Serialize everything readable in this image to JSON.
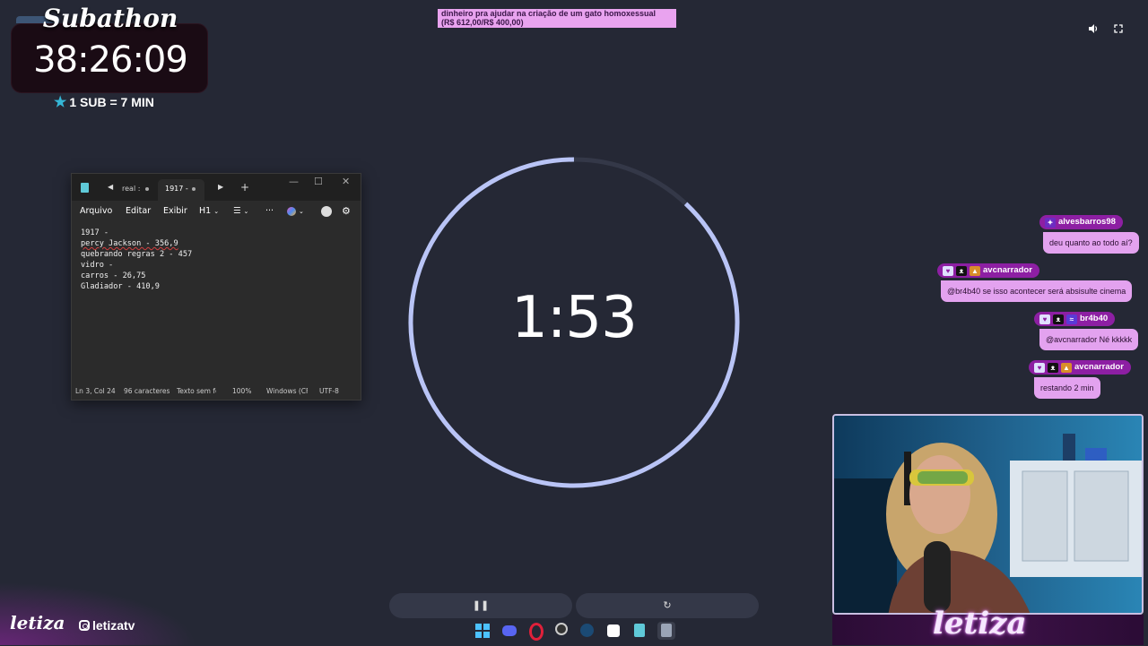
{
  "subathon": {
    "title": "Subathon",
    "time": "38:26:09",
    "rate": "1 SUB = 7 MIN"
  },
  "goal": {
    "line1": "dinheiro pra ajudar na criação de um gato homoxessual",
    "line2": "(R$ 612,00/R$ 400,00)",
    "progress": 1.0
  },
  "notepad": {
    "tabs": [
      "real :",
      "1917 -"
    ],
    "add_tab": "+",
    "menu": [
      "Arquivo",
      "Editar",
      "Exibir",
      "H1"
    ],
    "lines": [
      "1917 -",
      "percy Jackson - 356,9",
      "quebrando regras 2 - 457",
      "vidro -",
      "carros - 26,75",
      "Gladiador - 410,9"
    ],
    "status": {
      "position": "Ln 3, Col 24",
      "chars": "96 caracteres",
      "format": "Texto sem fo",
      "zoom": "100%",
      "eol": "Windows (CF",
      "encoding": "UTF-8"
    }
  },
  "timer": {
    "display": "1:53",
    "remaining_fraction": 0.88
  },
  "chat": [
    {
      "user": "alvesbarros98",
      "message": "deu quanto ao todo aí?"
    },
    {
      "user": "avcnarrador",
      "message": "@br4b40 se isso acontecer será absisulte cinema"
    },
    {
      "user": "br4b40",
      "message": "@avcnarrador Né kkkkk"
    },
    {
      "user": "avcnarrador",
      "message": "restando 2 min"
    }
  ],
  "branding": {
    "logo": "letiza",
    "handle": "letizatv",
    "webcam_logo": "letiza"
  },
  "icons": [
    "volume-icon",
    "fullscreen-icon",
    "pause-icon",
    "reset-icon",
    "star-icon",
    "instagram-icon"
  ],
  "colors": {
    "background": "#252835",
    "ring": "#b9c4f6",
    "chat_name": "#8d1fa3",
    "chat_bubble": "#e3a2ef"
  }
}
